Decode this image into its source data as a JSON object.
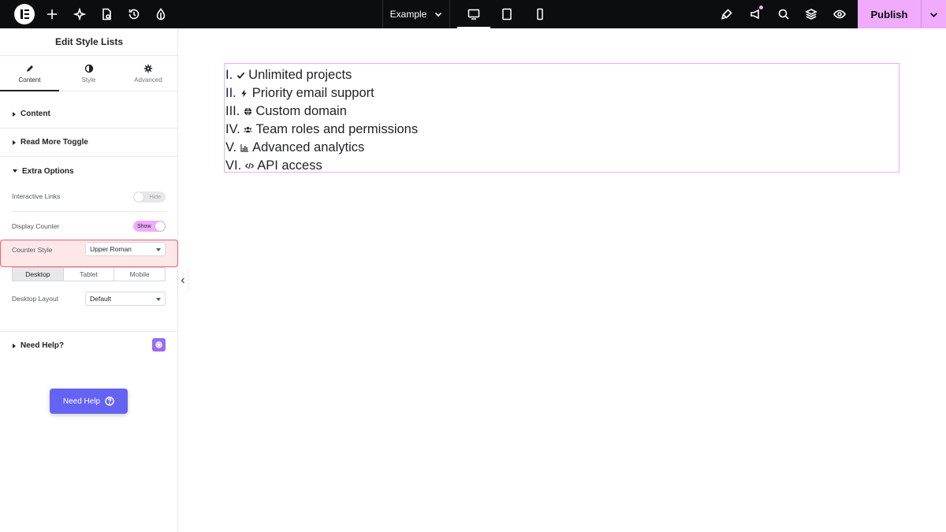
{
  "topbar": {
    "page_name": "Example",
    "publish_label": "Publish"
  },
  "sidebar": {
    "title": "Edit Style Lists",
    "tabs": [
      {
        "label": "Content",
        "icon": "pencil-icon"
      },
      {
        "label": "Style",
        "icon": "half-circle-icon"
      },
      {
        "label": "Advanced",
        "icon": "gear-icon"
      }
    ],
    "sections": {
      "content": "Content",
      "read_more": "Read More Toggle",
      "extra": "Extra Options",
      "need_help": "Need Help?"
    },
    "controls": {
      "interactive_links_label": "Interactive Links",
      "interactive_links_state": "Hide",
      "display_counter_label": "Display Counter",
      "display_counter_state": "Show",
      "counter_style_label": "Counter Style",
      "counter_style_value": "Upper Roman",
      "devices": [
        "Desktop",
        "Tablet",
        "Mobile"
      ],
      "desktop_layout_label": "Desktop Layout",
      "desktop_layout_value": "Default"
    },
    "help_button": "Need Help"
  },
  "list": {
    "items": [
      {
        "counter": "I.",
        "icon": "check-icon",
        "text": "Unlimited projects"
      },
      {
        "counter": "II.",
        "icon": "bolt-icon",
        "text": "Priority email support"
      },
      {
        "counter": "III.",
        "icon": "globe-icon",
        "text": "Custom domain"
      },
      {
        "counter": "IV.",
        "icon": "users-icon",
        "text": "Team roles and permissions"
      },
      {
        "counter": "V.",
        "icon": "chart-icon",
        "text": "Advanced analytics"
      },
      {
        "counter": "VI.",
        "icon": "code-icon",
        "text": "API access"
      }
    ]
  },
  "colors": {
    "accent": "#f0abfc",
    "topbar": "#0c0d0e",
    "highlight_border": "#ef5d6f",
    "help_button": "#6563f3"
  }
}
